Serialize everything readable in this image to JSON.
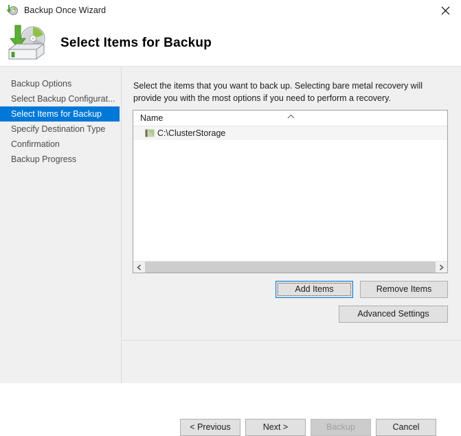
{
  "window": {
    "title": "Backup Once Wizard",
    "title_icon": "backup-disc-icon",
    "close_icon": "close-icon"
  },
  "header": {
    "icon": "backup-to-disk-icon",
    "title": "Select Items for Backup"
  },
  "sidebar": {
    "items": [
      {
        "label": "Backup Options",
        "active": false
      },
      {
        "label": "Select Backup Configurat...",
        "active": false
      },
      {
        "label": "Select Items for Backup",
        "active": true
      },
      {
        "label": "Specify Destination Type",
        "active": false
      },
      {
        "label": "Confirmation",
        "active": false
      },
      {
        "label": "Backup Progress",
        "active": false
      }
    ]
  },
  "main": {
    "instructions": "Select the items that you want to back up. Selecting bare metal recovery will provide you with the most options if you need to perform a recovery.",
    "list": {
      "column_header": "Name",
      "sort_indicator": "sort-ascending-icon",
      "rows": [
        {
          "label": "C:\\ClusterStorage",
          "icon": "folder-icon"
        }
      ],
      "scrollbar": {
        "left_arrow": "chevron-left-icon",
        "right_arrow": "chevron-right-icon"
      }
    },
    "buttons": {
      "add_items": "Add Items",
      "remove_items": "Remove Items",
      "advanced_settings": "Advanced Settings"
    }
  },
  "footer": {
    "previous": "< Previous",
    "next": "Next >",
    "backup": "Backup",
    "cancel": "Cancel"
  },
  "colors": {
    "accent": "#0078d7",
    "body_background": "#f0f0f0",
    "button_face": "#e1e1e1",
    "disabled_text": "#a0a0a0"
  }
}
